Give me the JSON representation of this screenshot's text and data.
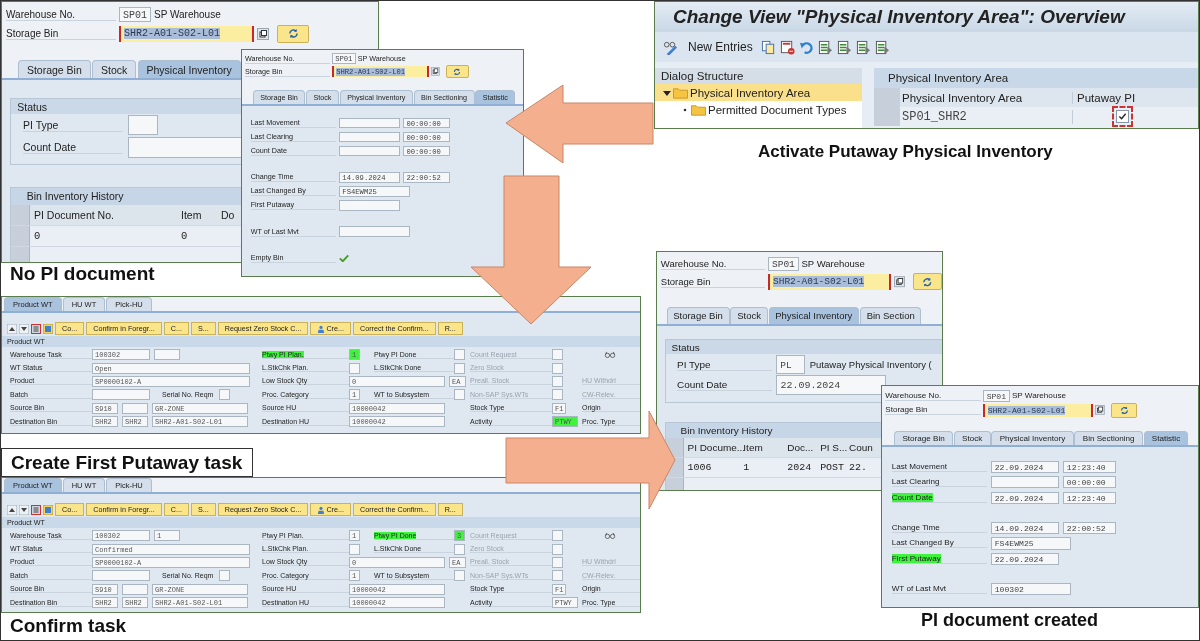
{
  "bin_screen_before": {
    "header": {
      "warehouse_label": "Warehouse No.",
      "warehouse": "SP01",
      "warehouse_name": "SP Warehouse",
      "bin_label": "Storage Bin",
      "bin": "SHR2-A01-S02-L01"
    },
    "tabs": [
      {
        "label": "Storage Bin",
        "selected": false
      },
      {
        "label": "Stock",
        "selected": false
      },
      {
        "label": "Physical Inventory",
        "selected": true
      }
    ],
    "status": {
      "title": "Status",
      "fields": [
        {
          "label": "PI Type",
          "kind": "code"
        },
        {
          "label": "Count Date",
          "kind": "date"
        }
      ]
    },
    "history": {
      "title": "Bin Inventory History",
      "columns": [
        "PI Document No.",
        "Item",
        "Do"
      ],
      "rows": [
        [
          "0",
          "0"
        ]
      ]
    }
  },
  "caption_no_document": "No PI document",
  "statistic_screen_before": {
    "header": {
      "warehouse_label": "Warehouse No.",
      "warehouse": "SP01",
      "warehouse_name": "SP Warehouse",
      "bin_label": "Storage Bin",
      "bin": "SHR2-A01-S02-L01"
    },
    "tabs": [
      {
        "label": "Storage Bin",
        "selected": false
      },
      {
        "label": "Stock",
        "selected": false
      },
      {
        "label": "Physical Inventory",
        "selected": false
      },
      {
        "label": "Bin Sectioning",
        "selected": false
      },
      {
        "label": "Statistic",
        "selected": true
      }
    ],
    "groups": [
      [
        {
          "label": "Last Movement",
          "kind": "datetime",
          "time": "00:00:00",
          "highlighted": false
        },
        {
          "label": "Last Clearing",
          "kind": "datetime",
          "time": "00:00:00",
          "highlighted": false
        },
        {
          "label": "Count Date",
          "kind": "datetime",
          "time": "00:00:00",
          "highlighted": false
        }
      ],
      [
        {
          "label": "Change Time",
          "kind": "datetime",
          "date": "14.09.2024",
          "time": "22:00:52",
          "highlighted": false
        },
        {
          "label": "Last Changed By",
          "kind": "text",
          "value": "FS4EWM25",
          "highlighted": false
        },
        {
          "label": "First Putaway",
          "kind": "date",
          "highlighted": false
        }
      ],
      [
        {
          "label": "WT of Last Mvt",
          "kind": "text",
          "highlighted": false
        }
      ],
      [
        {
          "label": "Empty Bin",
          "kind": "check",
          "checked": true,
          "highlighted": false
        }
      ]
    ]
  },
  "configuration": {
    "title": "Change View \"Physical Inventory Area\": Overview",
    "new_entries": "New Entries",
    "dialog_structure": {
      "title": "Dialog Structure",
      "tree": [
        {
          "label": "Physical Inventory Area",
          "selected": true,
          "expanded": true,
          "children": [
            {
              "label": "Permitted Document Types",
              "selected": false
            }
          ]
        }
      ]
    },
    "table": {
      "title": "Physical Inventory Area",
      "columns": [
        "Physical Inventory Area",
        "Putaway PI"
      ],
      "rows": [
        {
          "area": "SP01_SHR2",
          "putaway_pi": true
        }
      ]
    }
  },
  "caption_activate": "Activate Putaway Physical Inventory",
  "task_created": {
    "tabs": [
      {
        "label": "Product WT",
        "selected": true
      },
      {
        "label": "HU WT",
        "selected": false
      },
      {
        "label": "Pick-HU",
        "selected": false
      }
    ],
    "toolbar": [
      {
        "label": "Co...",
        "kind": "text"
      },
      {
        "label": "Confirm in Foregr...",
        "kind": "text"
      },
      {
        "label": "C...",
        "kind": "text"
      },
      {
        "label": "S...",
        "kind": "text"
      },
      {
        "label": "Request Zero Stock C...",
        "kind": "text"
      },
      {
        "label": "Cre...",
        "kind": "icon_text"
      },
      {
        "label": "Correct the Confirm...",
        "kind": "text"
      },
      {
        "label": "R...",
        "kind": "text"
      }
    ],
    "section_title": "Product WT",
    "rows": [
      {
        "left": {
          "label": "Warehouse Task",
          "boxes": [
            {
              "kind": "medium",
              "text": "100302"
            },
            {
              "kind": "short"
            }
          ]
        },
        "middle": {
          "label": "Ptwy PI Plan.",
          "highlighted": true,
          "boxes": [
            {
              "kind": "tiny",
              "text": "1",
              "highlighted": true
            }
          ]
        },
        "right": {
          "label": "Ptwy PI Done",
          "highlighted": false,
          "boxes": [
            {
              "kind": "tiny",
              "highlighted": false
            }
          ]
        },
        "flag": {
          "label": "Count Request",
          "disabled": true,
          "boxes": [
            {
              "kind": "check",
              "checked": false
            }
          ]
        },
        "extra": {
          "kind": "icon"
        }
      },
      {
        "left": {
          "label": "WT Status",
          "boxes": [
            {
              "kind": "wide",
              "text": "Open"
            }
          ]
        },
        "middle": {
          "label": "L.StkChk Plan.",
          "boxes": [
            {
              "kind": "tiny"
            }
          ]
        },
        "right": {
          "label": "L.StkChk Done",
          "boxes": [
            {
              "kind": "tiny"
            }
          ]
        },
        "flag": {
          "label": "Zero Stock",
          "disabled": true,
          "boxes": [
            {
              "kind": "check",
              "checked": false
            }
          ]
        }
      },
      {
        "left": {
          "label": "Product",
          "boxes": [
            {
              "kind": "wide",
              "text": "SP0000102-A"
            }
          ]
        },
        "middle": {
          "label": "Low Stock Qty",
          "boxes": [
            {
              "kind": "long",
              "text": "0"
            },
            {
              "kind": "unit",
              "text": "EA"
            }
          ]
        },
        "flag": {
          "label": "Preall. Stock",
          "disabled": true,
          "boxes": [
            {
              "kind": "check",
              "checked": false
            }
          ]
        },
        "extra": {
          "kind": "label",
          "label": "HU Withdrl",
          "disabled": true
        }
      },
      {
        "left": {
          "label": "Batch",
          "boxes": [
            {
              "kind": "medium"
            },
            {
              "kind": "label",
              "text": "Serial No. Reqm"
            },
            {
              "kind": "tiny"
            }
          ]
        },
        "middle": {
          "label": "Proc. Category",
          "boxes": [
            {
              "kind": "tiny",
              "text": "1"
            }
          ]
        },
        "right": {
          "label": "WT to Subsystem",
          "boxes": [
            {
              "kind": "tiny"
            }
          ]
        },
        "flag": {
          "label": "Non-SAP Sys.WTs",
          "disabled": true,
          "boxes": [
            {
              "kind": "check",
              "checked": false
            }
          ]
        },
        "extra": {
          "kind": "label",
          "label": "CW-Relev.",
          "disabled": true
        }
      },
      {
        "left": {
          "label": "Source Bin",
          "boxes": [
            {
              "kind": "short",
              "text": "S910"
            },
            {
              "kind": "short"
            },
            {
              "kind": "long",
              "text": "GR-ZONE"
            }
          ]
        },
        "middle": {
          "label": "Source HU",
          "boxes": [
            {
              "kind": "long",
              "text": "10000042"
            }
          ]
        },
        "flag": {
          "label": "Stock Type",
          "disabled": false,
          "boxes": [
            {
              "kind": "tiny",
              "text": "F1"
            }
          ]
        },
        "extra": {
          "kind": "label",
          "label": "Origin",
          "disabled": false
        }
      },
      {
        "left": {
          "label": "Destination Bin",
          "boxes": [
            {
              "kind": "short",
              "text": "SHR2"
            },
            {
              "kind": "short",
              "text": "SHR2"
            },
            {
              "kind": "long",
              "text": "SHR2-A01-S02-L01"
            }
          ]
        },
        "middle": {
          "label": "Destination HU",
          "boxes": [
            {
              "kind": "long",
              "text": "10000042"
            }
          ]
        },
        "flag": {
          "label": "Activity",
          "disabled": false,
          "boxes": [
            {
              "kind": "short",
              "text": "PTWY",
              "highlighted": true
            }
          ]
        },
        "extra": {
          "kind": "label",
          "label": "Proc. Type",
          "disabled": false
        }
      }
    ]
  },
  "caption_create": "Create First Putaway task",
  "task_confirmed": {
    "tabs": [
      {
        "label": "Product WT",
        "selected": true
      },
      {
        "label": "HU WT",
        "selected": false
      },
      {
        "label": "Pick-HU",
        "selected": false
      }
    ],
    "toolbar": [
      {
        "label": "Co...",
        "kind": "text"
      },
      {
        "label": "Confirm in Foregr...",
        "kind": "text"
      },
      {
        "label": "C...",
        "kind": "text"
      },
      {
        "label": "S...",
        "kind": "text"
      },
      {
        "label": "Request Zero Stock C...",
        "kind": "text"
      },
      {
        "label": "Cre...",
        "kind": "icon_text"
      },
      {
        "label": "Correct the Confirm...",
        "kind": "text"
      },
      {
        "label": "R...",
        "kind": "text"
      }
    ],
    "section_title": "Product WT",
    "rows": [
      {
        "left": {
          "label": "Warehouse Task",
          "boxes": [
            {
              "kind": "medium",
              "text": "100302"
            },
            {
              "kind": "short",
              "text": "1"
            }
          ]
        },
        "middle": {
          "label": "Ptwy PI Plan.",
          "highlighted": false,
          "boxes": [
            {
              "kind": "tiny",
              "text": "1",
              "highlighted": false
            }
          ]
        },
        "right": {
          "label": "Ptwy PI Done",
          "highlighted": true,
          "boxes": [
            {
              "kind": "tiny",
              "text": "3",
              "highlighted": true
            }
          ]
        },
        "flag": {
          "label": "Count Request",
          "disabled": true,
          "boxes": [
            {
              "kind": "check",
              "checked": false
            }
          ]
        },
        "extra": {
          "kind": "icon"
        }
      },
      {
        "left": {
          "label": "WT Status",
          "boxes": [
            {
              "kind": "wide",
              "text": "Confirmed"
            }
          ]
        },
        "middle": {
          "label": "L.StkChk Plan.",
          "boxes": [
            {
              "kind": "tiny"
            }
          ]
        },
        "right": {
          "label": "L.StkChk Done",
          "boxes": [
            {
              "kind": "tiny"
            }
          ]
        },
        "flag": {
          "label": "Zero Stock",
          "disabled": true,
          "boxes": [
            {
              "kind": "check",
              "checked": false
            }
          ]
        }
      },
      {
        "left": {
          "label": "Product",
          "boxes": [
            {
              "kind": "wide",
              "text": "SP0000102-A"
            }
          ]
        },
        "middle": {
          "label": "Low Stock Qty",
          "boxes": [
            {
              "kind": "long",
              "text": "0"
            },
            {
              "kind": "unit",
              "text": "EA"
            }
          ]
        },
        "flag": {
          "label": "Preall. Stock",
          "disabled": true,
          "boxes": [
            {
              "kind": "check",
              "checked": false
            }
          ]
        },
        "extra": {
          "kind": "label",
          "label": "HU Withdrl",
          "disabled": true
        }
      },
      {
        "left": {
          "label": "Batch",
          "boxes": [
            {
              "kind": "medium"
            },
            {
              "kind": "label",
              "text": "Serial No. Reqm"
            },
            {
              "kind": "tiny"
            }
          ]
        },
        "middle": {
          "label": "Proc. Category",
          "boxes": [
            {
              "kind": "tiny",
              "text": "1"
            }
          ]
        },
        "right": {
          "label": "WT to Subsystem",
          "boxes": [
            {
              "kind": "tiny"
            }
          ]
        },
        "flag": {
          "label": "Non-SAP Sys.WTs",
          "disabled": true,
          "boxes": [
            {
              "kind": "check",
              "checked": false
            }
          ]
        },
        "extra": {
          "kind": "label",
          "label": "CW-Relev.",
          "disabled": true
        }
      },
      {
        "left": {
          "label": "Source Bin",
          "boxes": [
            {
              "kind": "short",
              "text": "S910"
            },
            {
              "kind": "short"
            },
            {
              "kind": "long",
              "text": "GR-ZONE"
            }
          ]
        },
        "middle": {
          "label": "Source HU",
          "boxes": [
            {
              "kind": "long",
              "text": "10000042"
            }
          ]
        },
        "flag": {
          "label": "Stock Type",
          "disabled": false,
          "boxes": [
            {
              "kind": "tiny",
              "text": "F1"
            }
          ]
        },
        "extra": {
          "kind": "label",
          "label": "Origin",
          "disabled": false
        }
      },
      {
        "left": {
          "label": "Destination Bin",
          "boxes": [
            {
              "kind": "short",
              "text": "SHR2"
            },
            {
              "kind": "short",
              "text": "SHR2"
            },
            {
              "kind": "long",
              "text": "SHR2-A01-S02-L01"
            }
          ]
        },
        "middle": {
          "label": "Destination HU",
          "boxes": [
            {
              "kind": "long",
              "text": "10000042"
            }
          ]
        },
        "flag": {
          "label": "Activity",
          "disabled": false,
          "boxes": [
            {
              "kind": "short",
              "text": "PTWY",
              "highlighted": false
            }
          ]
        },
        "extra": {
          "kind": "label",
          "label": "Proc. Type",
          "disabled": false
        }
      }
    ]
  },
  "caption_confirm": "Confirm task",
  "bin_screen_after": {
    "header": {
      "warehouse_label": "Warehouse No.",
      "warehouse": "SP01",
      "warehouse_name": "SP Warehouse",
      "bin_label": "Storage Bin",
      "bin": "SHR2-A01-S02-L01"
    },
    "tabs": [
      {
        "label": "Storage Bin",
        "selected": false
      },
      {
        "label": "Stock",
        "selected": false
      },
      {
        "label": "Physical Inventory",
        "selected": true
      },
      {
        "label": "Bin Section",
        "selected": false
      }
    ],
    "status": {
      "title": "Status",
      "fields": [
        {
          "label": "PI Type",
          "kind": "code",
          "value": "PL",
          "description": "Putaway Physical Inventory ("
        },
        {
          "label": "Count Date",
          "kind": "date",
          "value": "22.09.2024"
        }
      ]
    },
    "history": {
      "title": "Bin Inventory History",
      "columns": [
        "PI Docume...",
        "Item",
        "Doc...",
        "PI S...",
        "Coun"
      ],
      "rows": [
        [
          "1006",
          "1",
          "2024",
          "POST",
          "22."
        ]
      ]
    }
  },
  "statistic_screen_after": {
    "header": {
      "warehouse_label": "Warehouse No.",
      "warehouse": "SP01",
      "warehouse_name": "SP Warehouse",
      "bin_label": "Storage Bin",
      "bin": "SHR2-A01-S02-L01"
    },
    "tabs": [
      {
        "label": "Storage Bin",
        "selected": false
      },
      {
        "label": "Stock",
        "selected": false
      },
      {
        "label": "Physical Inventory",
        "selected": false
      },
      {
        "label": "Bin Sectioning",
        "selected": false
      },
      {
        "label": "Statistic",
        "selected": true
      }
    ],
    "groups": [
      [
        {
          "label": "Last Movement",
          "kind": "datetime",
          "date": "22.09.2024",
          "time": "12:23:40",
          "highlighted": false
        },
        {
          "label": "Last Clearing",
          "kind": "datetime",
          "time": "00:00:00",
          "highlighted": false
        },
        {
          "label": "Count Date",
          "kind": "datetime",
          "date": "22.09.2024",
          "time": "12:23:40",
          "highlighted": true
        }
      ],
      [
        {
          "label": "Change Time",
          "kind": "datetime",
          "date": "14.09.2024",
          "time": "22:00:52",
          "highlighted": false
        },
        {
          "label": "Last Changed By",
          "kind": "text",
          "value": "FS4EWM25",
          "highlighted": false
        },
        {
          "label": "First Putaway",
          "kind": "date",
          "date": "22.09.2024",
          "highlighted": true
        }
      ],
      [
        {
          "label": "WT of Last Mvt",
          "kind": "text",
          "value": "100302",
          "highlighted": false
        }
      ]
    ]
  },
  "caption_created": "PI document created"
}
